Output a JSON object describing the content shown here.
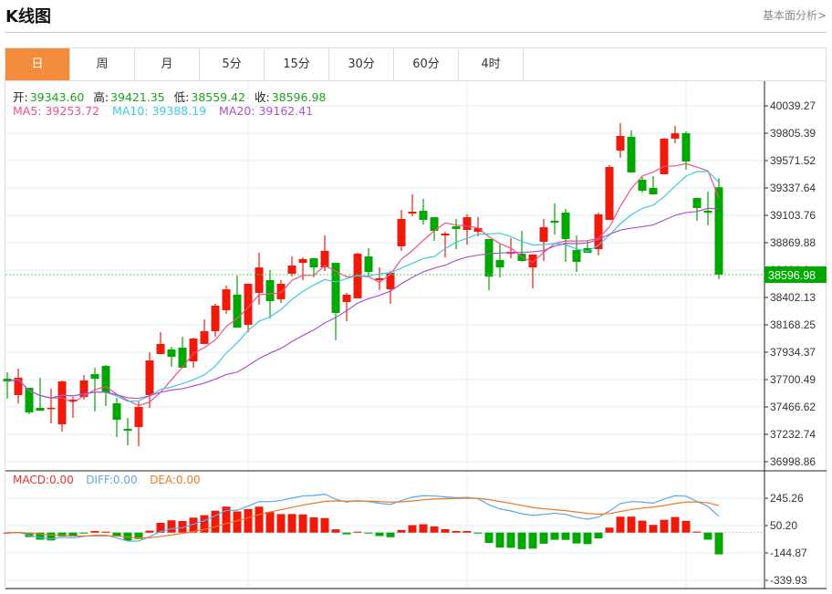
{
  "header": {
    "title": "K线图",
    "link": "基本面分析>"
  },
  "tabs": [
    {
      "label": "日",
      "active": true
    },
    {
      "label": "周"
    },
    {
      "label": "月"
    },
    {
      "label": "5分"
    },
    {
      "label": "15分"
    },
    {
      "label": "30分"
    },
    {
      "label": "60分"
    },
    {
      "label": "4时"
    }
  ],
  "ohlc_legend": {
    "open_label": "开:",
    "open": "39343.60",
    "high_label": "高:",
    "high": "39421.35",
    "low_label": "低:",
    "low": "38559.42",
    "close_label": "收:",
    "close": "38596.98"
  },
  "ma_legend": {
    "ma5": "MA5: 39253.72",
    "ma10": "MA10: 39388.19",
    "ma20": "MA20: 39162.41"
  },
  "macd_legend": {
    "macd": "MACD:0.00",
    "diff": "DIFF:0.00",
    "dea": "DEA:0.00"
  },
  "colors": {
    "up": "#f01a0a",
    "down": "#00a800",
    "ma5": "#f0508a",
    "ma10": "#40c8e0",
    "ma20": "#b050d0",
    "diff": "#5aa8f0",
    "dea": "#f07820",
    "active_tab": "#f28b3c"
  },
  "chart_data": [
    {
      "type": "candlestick",
      "ylim": [
        36998.86,
        40039.27
      ],
      "y_ticks": [
        "40039.27",
        "39805.39",
        "39571.52",
        "39337.64",
        "39103.76",
        "38869.88",
        "38636.01",
        "38402.13",
        "38168.25",
        "37934.37",
        "37700.49",
        "37466.62",
        "37232.74",
        "36998.86"
      ],
      "current_price": "38596.98",
      "grid": true,
      "ohlc": [
        [
          37708,
          37763,
          37537,
          37685
        ],
        [
          37568,
          37794,
          37498,
          37716
        ],
        [
          37630,
          37632,
          37404,
          37420
        ],
        [
          37459,
          37716,
          37435,
          37435
        ],
        [
          37451,
          37622,
          37326,
          37459
        ],
        [
          37318,
          37693,
          37256,
          37685
        ],
        [
          37513,
          37552,
          37373,
          37529
        ],
        [
          37552,
          37739,
          37529,
          37693
        ],
        [
          37747,
          37802,
          37428,
          37708
        ],
        [
          37817,
          37825,
          37474,
          37591
        ],
        [
          37498,
          37545,
          37209,
          37357
        ],
        [
          37280,
          37373,
          37139,
          37264
        ],
        [
          37295,
          37513,
          37131,
          37467
        ],
        [
          37568,
          37934,
          37459,
          37864
        ],
        [
          37919,
          38106,
          37919,
          38005
        ],
        [
          37958,
          37981,
          37810,
          37895
        ],
        [
          37973,
          38067,
          37802,
          37802
        ],
        [
          37856,
          38059,
          37802,
          38051
        ],
        [
          38005,
          38215,
          38005,
          38114
        ],
        [
          38114,
          38348,
          38067,
          38332
        ],
        [
          38293,
          38503,
          38262,
          38472
        ],
        [
          38426,
          38589,
          38145,
          38145
        ],
        [
          38168,
          38521,
          38106,
          38519
        ],
        [
          38441,
          38784,
          38340,
          38659
        ],
        [
          38550,
          38636,
          38223,
          38371
        ],
        [
          38387,
          38552,
          38355,
          38519
        ],
        [
          38605,
          38753,
          38581,
          38675
        ],
        [
          38698,
          38745,
          38550,
          38730
        ],
        [
          38737,
          38739,
          38574,
          38659
        ],
        [
          38659,
          38932,
          38628,
          38800
        ],
        [
          38698,
          38700,
          38036,
          38270
        ],
        [
          38363,
          38441,
          38199,
          38426
        ],
        [
          38394,
          38784,
          38394,
          38776
        ],
        [
          38753,
          38823,
          38589,
          38620
        ],
        [
          38550,
          38659,
          38465,
          38566
        ],
        [
          38472,
          38628,
          38348,
          38613
        ],
        [
          38839,
          39150,
          38800,
          39073
        ],
        [
          39119,
          39283,
          39096,
          39135
        ],
        [
          39143,
          39244,
          39026,
          39065
        ],
        [
          39088,
          39090,
          38886,
          38971
        ],
        [
          38932,
          38963,
          38745,
          38948
        ],
        [
          39010,
          39073,
          38815,
          38987
        ],
        [
          38979,
          39112,
          38854,
          39088
        ],
        [
          38963,
          39090,
          38924,
          38995
        ],
        [
          38901,
          38903,
          38465,
          38581
        ],
        [
          38722,
          38862,
          38574,
          38659
        ],
        [
          38776,
          38909,
          38737,
          38792
        ],
        [
          38776,
          38971,
          38706,
          38714
        ],
        [
          38659,
          38770,
          38480,
          38769
        ],
        [
          38878,
          39073,
          38714,
          39002
        ],
        [
          39057,
          39205,
          38940,
          39041
        ],
        [
          39127,
          39158,
          38706,
          38901
        ],
        [
          38808,
          38932,
          38620,
          38706
        ],
        [
          38823,
          38893,
          38782,
          38784
        ],
        [
          38815,
          39127,
          38761,
          39112
        ],
        [
          39065,
          39533,
          39063,
          39517
        ],
        [
          39657,
          39891,
          39595,
          39782
        ],
        [
          39774,
          39829,
          39468,
          39470
        ],
        [
          39408,
          39431,
          39299,
          39314
        ],
        [
          39338,
          39439,
          39281,
          39283
        ],
        [
          39455,
          39766,
          39453,
          39759
        ],
        [
          39759,
          39868,
          39720,
          39805
        ],
        [
          39805,
          39821,
          39494,
          39564
        ],
        [
          39252,
          39254,
          39057,
          39166
        ],
        [
          39143,
          39306,
          39018,
          39127
        ],
        [
          39343.6,
          39421.35,
          38559.42,
          38596.98
        ]
      ],
      "ma_periods": [
        5,
        10,
        20
      ]
    },
    {
      "type": "bar",
      "ylim": [
        -339.93,
        245.26
      ],
      "y_ticks": [
        "245.26",
        "50.20",
        "-144.87",
        "-339.93"
      ],
      "indicator": "MACD"
    }
  ]
}
